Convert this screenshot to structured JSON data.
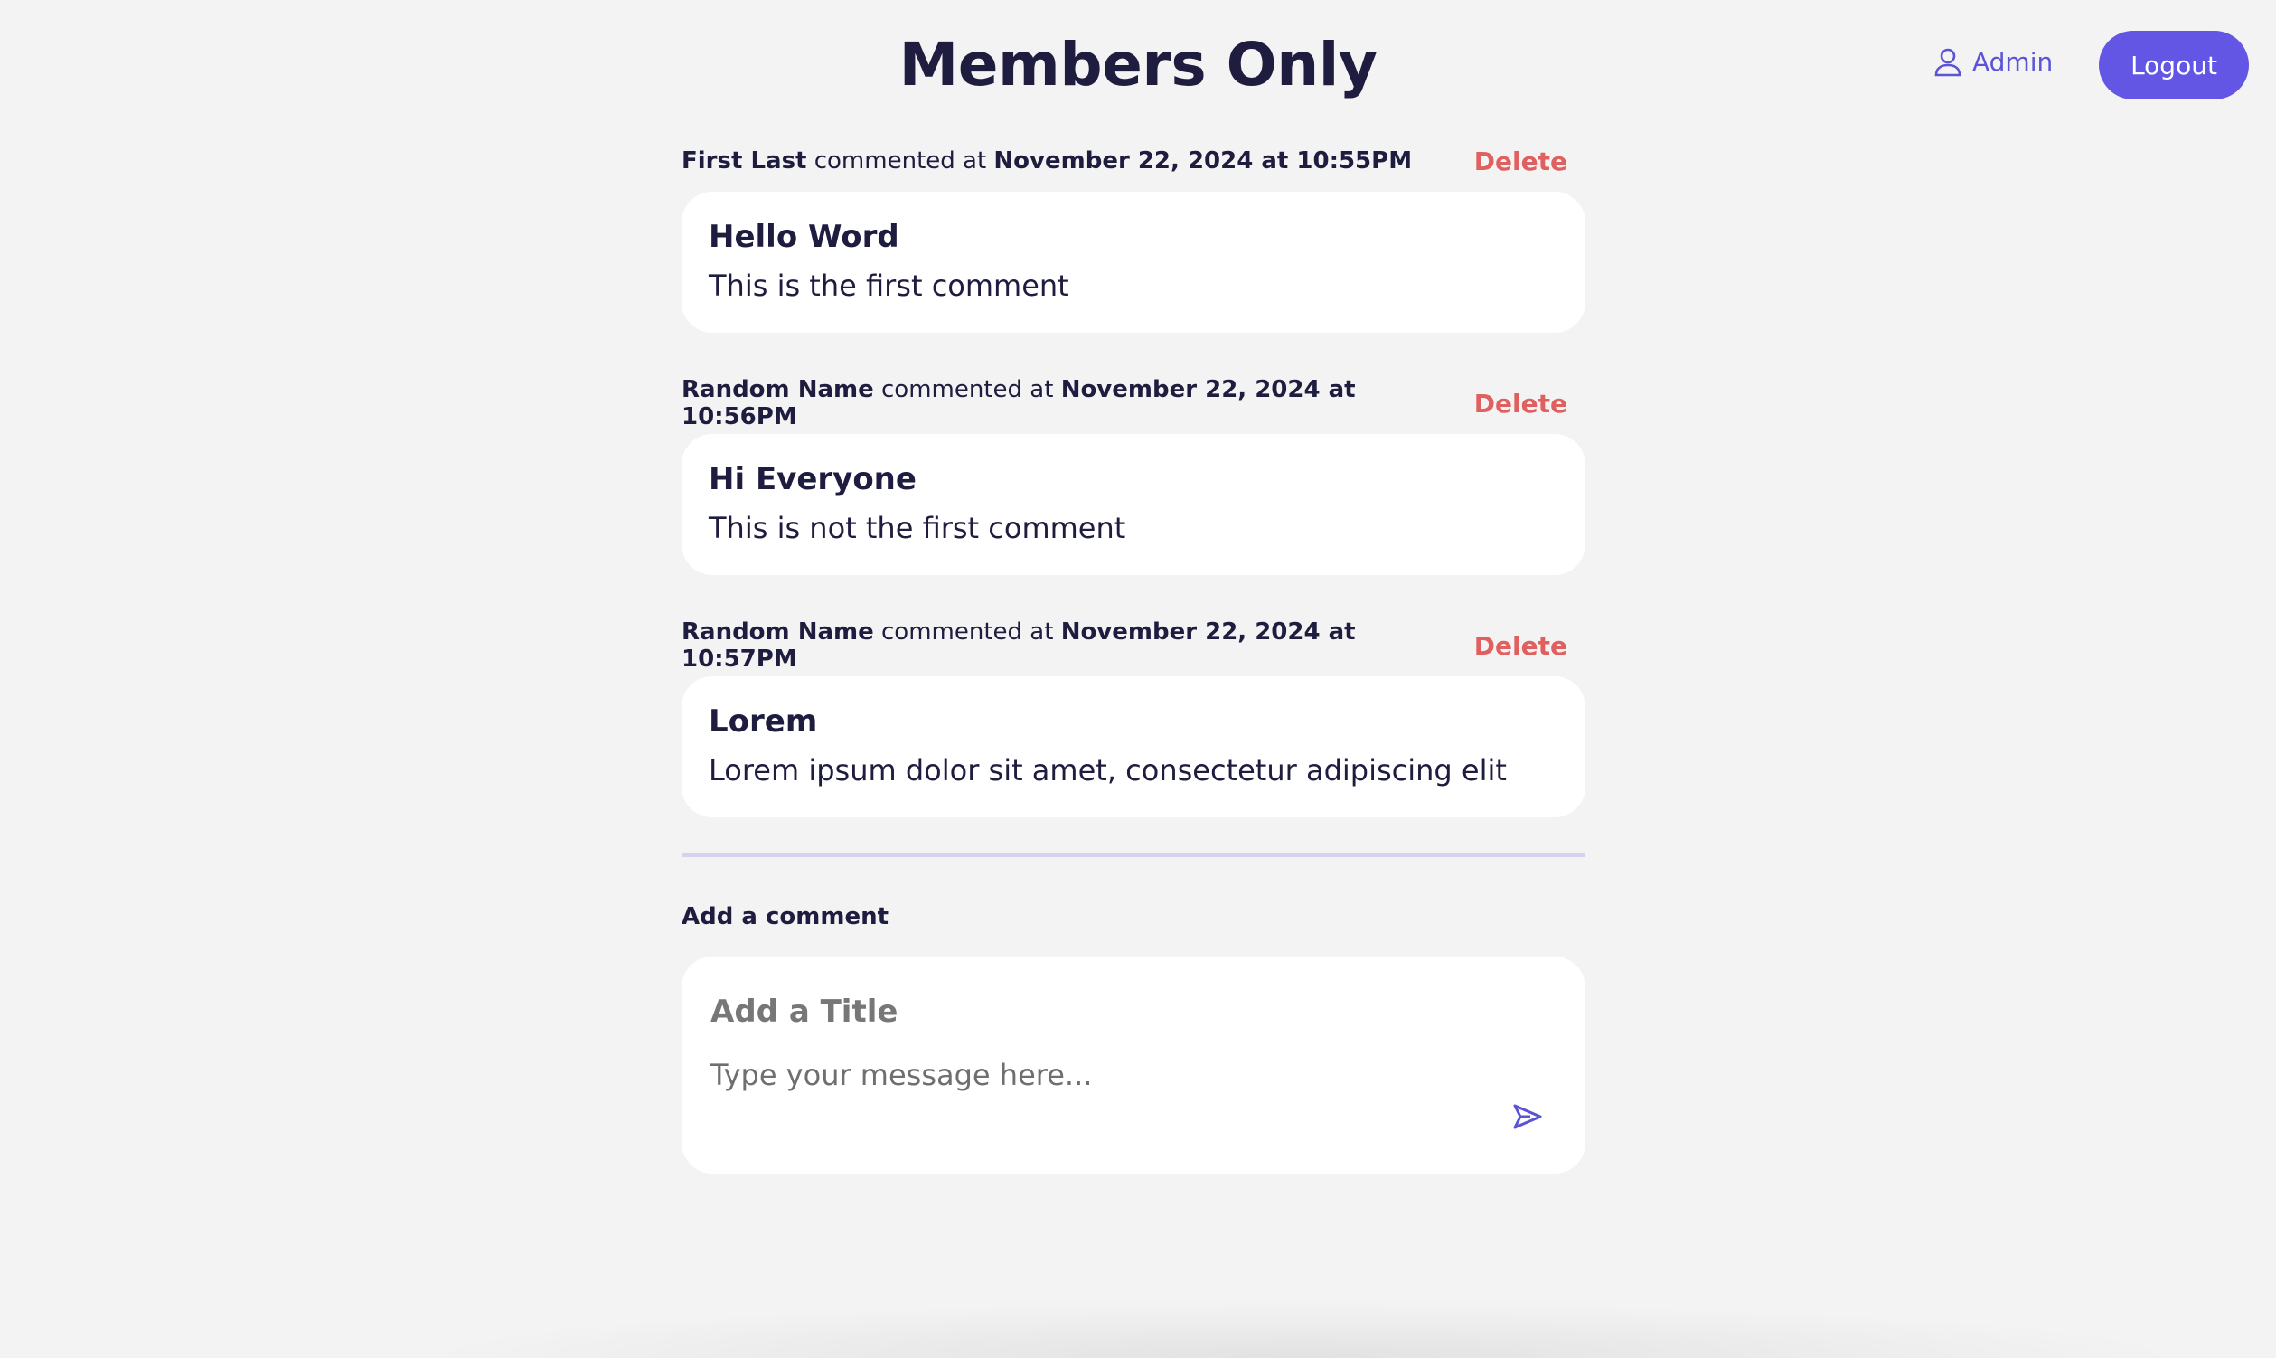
{
  "header": {
    "title": "Members Only",
    "admin_label": "Admin",
    "logout_label": "Logout"
  },
  "comments": [
    {
      "author": "First Last",
      "connector": "commented at",
      "timestamp": "November 22, 2024 at 10:55PM",
      "delete_label": "Delete",
      "title": "Hello Word",
      "body": "This is the first comment"
    },
    {
      "author": "Random Name",
      "connector": "commented at",
      "timestamp": "November 22, 2024 at 10:56PM",
      "delete_label": "Delete",
      "title": "Hi Everyone",
      "body": "This is not the first comment"
    },
    {
      "author": "Random Name",
      "connector": "commented at",
      "timestamp": "November 22, 2024 at 10:57PM",
      "delete_label": "Delete",
      "title": "Lorem",
      "body": "Lorem ipsum dolor sit amet, consectetur adipiscing elit"
    }
  ],
  "compose": {
    "label": "Add a comment",
    "title_placeholder": "Add a Title",
    "message_placeholder": "Type your message here..."
  },
  "icons": {
    "admin": "user-icon",
    "send": "send-icon"
  },
  "colors": {
    "accent": "#6356e5",
    "delete": "#e06060",
    "text": "#1f1d3f",
    "background": "#f3f3f3"
  }
}
